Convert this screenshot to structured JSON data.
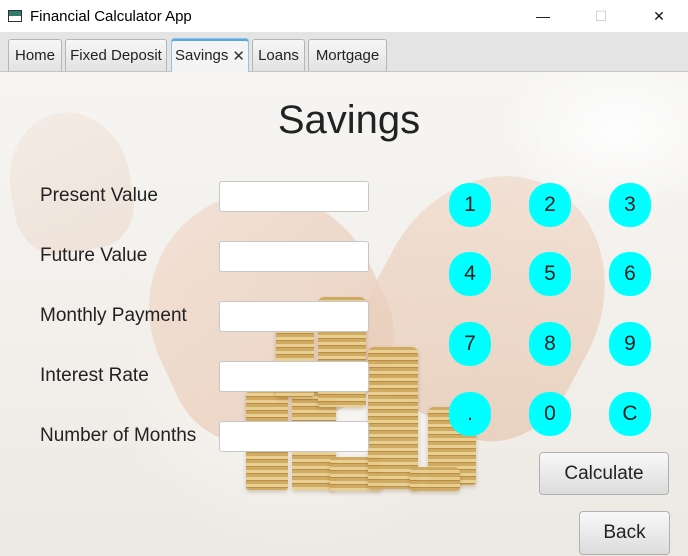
{
  "window": {
    "title": "Financial Calculator App",
    "minimize_glyph": "—",
    "maximize_glyph": "☐",
    "close_glyph": "✕"
  },
  "tabs": [
    {
      "label": "Home"
    },
    {
      "label": "Fixed Deposit"
    },
    {
      "label": "Savings",
      "active": true,
      "close_glyph": "✕"
    },
    {
      "label": "Loans"
    },
    {
      "label": "Mortgage"
    }
  ],
  "page": {
    "heading": "Savings",
    "fields": [
      {
        "label": "Present Value",
        "value": ""
      },
      {
        "label": "Future Value",
        "value": ""
      },
      {
        "label": "Monthly Payment",
        "value": ""
      },
      {
        "label": "Interest Rate",
        "value": ""
      },
      {
        "label": "Number of Months",
        "value": ""
      }
    ],
    "keypad": [
      "1",
      "2",
      "3",
      "4",
      "5",
      "6",
      "7",
      "8",
      "9",
      ".",
      "0",
      "C"
    ],
    "keypad_color": "#00ffff",
    "calculate_label": "Calculate",
    "back_label": "Back"
  }
}
